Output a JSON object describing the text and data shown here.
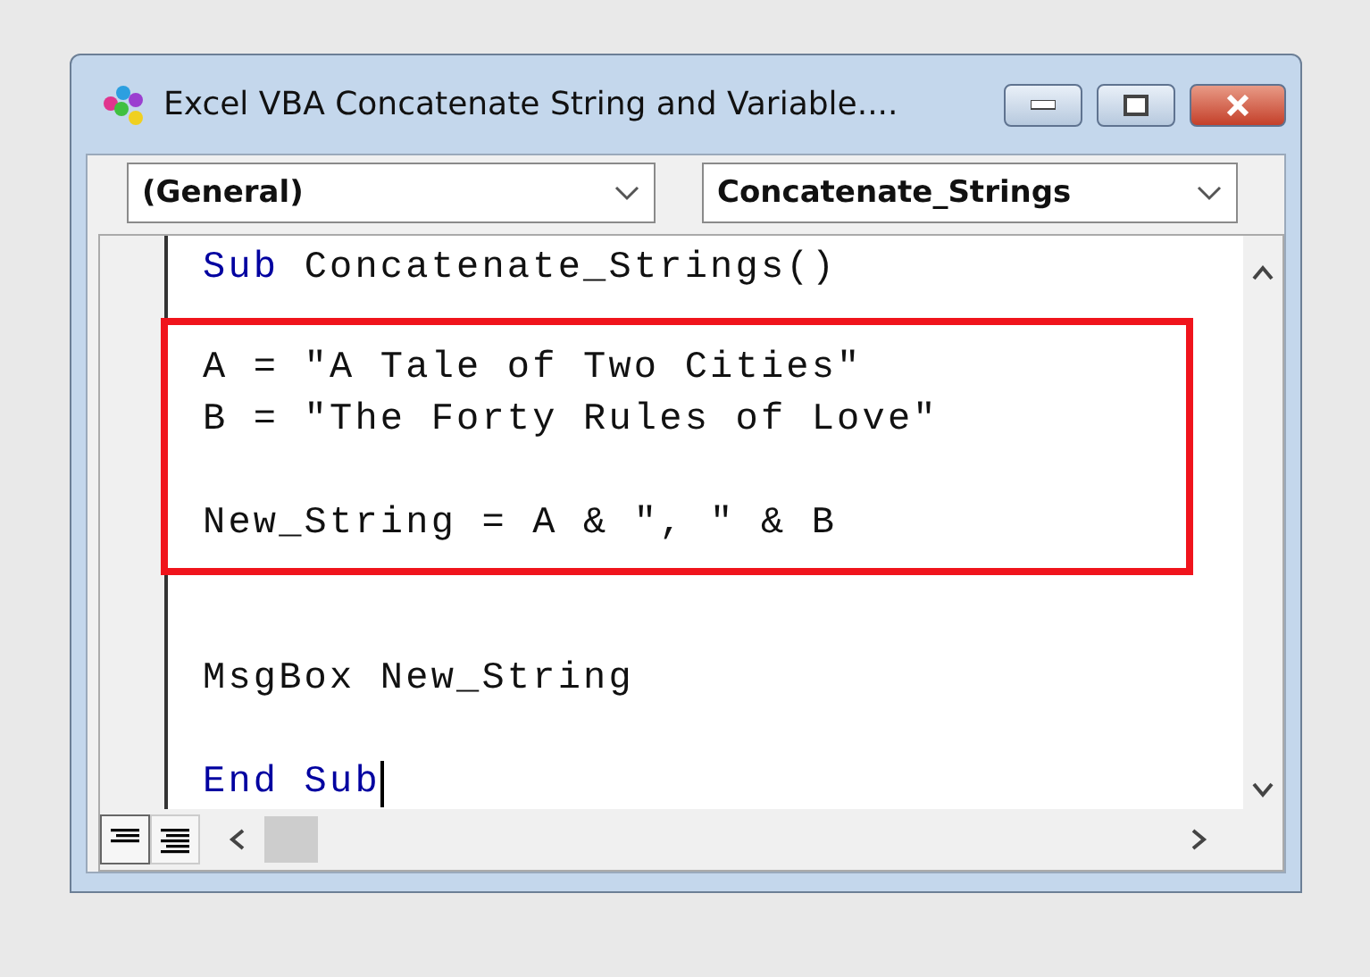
{
  "window": {
    "title": "Excel VBA Concatenate String and Variable...."
  },
  "dropdowns": [
    {
      "value": "(General)"
    },
    {
      "value": "Concatenate_Strings"
    }
  ],
  "code": [
    {
      "kind": "line",
      "caret": false,
      "tokens": [
        {
          "text": "Sub ",
          "kind": "keyword"
        },
        {
          "text": "Concatenate_Strings()",
          "kind": "plain"
        }
      ]
    },
    {
      "kind": "highlight",
      "lines": [
        {
          "kind": "line",
          "caret": false,
          "tokens": [
            {
              "text": "A = \"A Tale of Two Cities\"",
              "kind": "plain"
            }
          ]
        },
        {
          "kind": "line",
          "caret": false,
          "tokens": [
            {
              "text": "B = \"The Forty Rules of Love\"",
              "kind": "plain"
            }
          ]
        },
        {
          "kind": "blank"
        },
        {
          "kind": "line",
          "caret": false,
          "tokens": [
            {
              "text": "New_String = A & \", \" & B",
              "kind": "plain"
            }
          ]
        }
      ]
    },
    {
      "kind": "blank"
    },
    {
      "kind": "line",
      "caret": false,
      "tokens": [
        {
          "text": "MsgBox New_String",
          "kind": "plain"
        }
      ]
    },
    {
      "kind": "blank"
    },
    {
      "kind": "line",
      "caret": true,
      "tokens": [
        {
          "text": "End Sub",
          "kind": "keyword"
        }
      ]
    }
  ]
}
